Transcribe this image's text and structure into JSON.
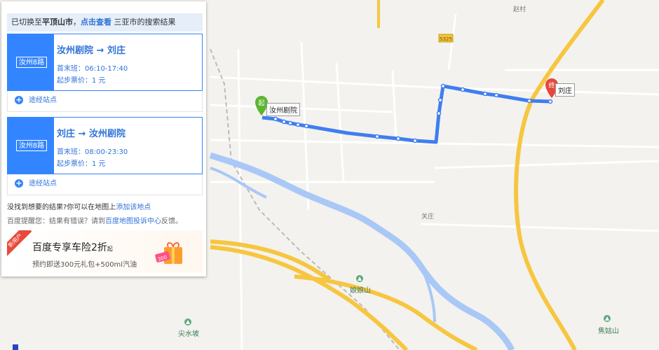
{
  "notice": {
    "prefix": "已切换至",
    "city": "平顶山市",
    "sep": "，",
    "view_link": "点击查看",
    "other_city": "三亚市",
    "suffix": "的搜索结果"
  },
  "routes": [
    {
      "badge": "汝州8路",
      "from": "汝州剧院",
      "arrow": "→",
      "to": "刘庄",
      "time_label": "首末班：",
      "time_value": "06:10-17:40",
      "fare_label": "起步票价：",
      "fare_value": "1 元",
      "stops_label": "途经站点"
    },
    {
      "badge": "汝州8路",
      "from": "刘庄",
      "arrow": "→",
      "to": "汝州剧院",
      "time_label": "首末班：",
      "time_value": "08:00-23:30",
      "fare_label": "起步票价：",
      "fare_value": "1 元",
      "stops_label": "途经站点"
    }
  ],
  "hints": {
    "not_found": "没找到想要的结果?你可以在地图上",
    "add_place": "添加该地点",
    "reminder_prefix": "百度提醒您：结果有错误？请到",
    "complaint_center": "百度地图投诉中心",
    "reminder_suffix": "反馈。"
  },
  "ad": {
    "ribbon": "新用户",
    "title": "百度专享车险2折",
    "title_suffix": "起",
    "subtitle": "预约即送300元礼包+500ml汽油",
    "coupon": "300"
  },
  "map": {
    "start_marker": "起",
    "end_marker": "终",
    "start_station": "汝州剧院",
    "end_station": "刘庄",
    "labels": {
      "zhao_cun": "赵村",
      "road_s": "S325",
      "guan_zhuang": "关庄",
      "niangniang_shan": "娘娘山",
      "jiangu_shan": "焦姑山",
      "jian_shui_po": "尖水坡"
    },
    "colors": {
      "route": "#3f7ef0",
      "highway": "#f7c640",
      "river": "#a9c8f6",
      "start_green": "#5cb531",
      "end_red": "#e8473a"
    }
  }
}
